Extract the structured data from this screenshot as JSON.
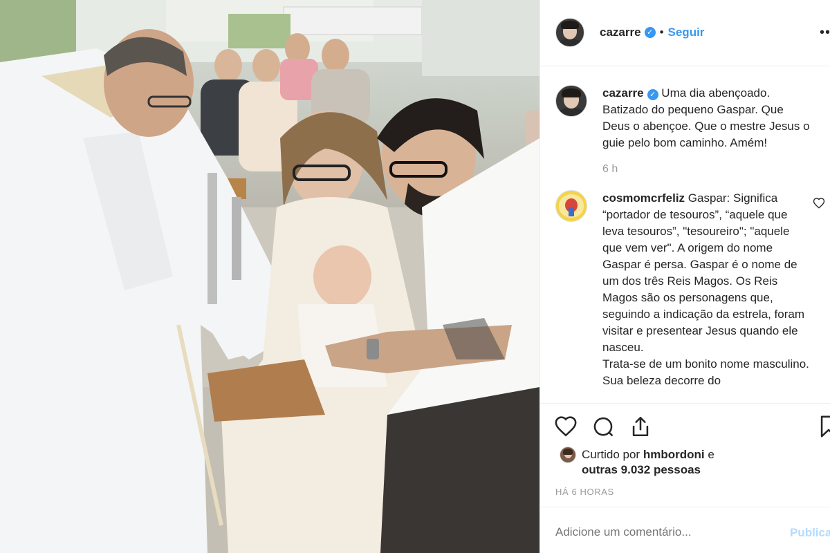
{
  "post": {
    "username": "cazarre",
    "verified_mark": "✓",
    "separator": "•",
    "follow_label": "Seguir",
    "more_icon": "•••"
  },
  "caption": {
    "username": "cazarre",
    "text": "Uma dia abençoado. Batizado do pequeno Gaspar. Que Deus o abençoe. Que o mestre Jesus o guie pelo bom caminho. Amém!",
    "time": "6 h"
  },
  "comments": [
    {
      "username": "cosmomcrfeliz",
      "text": "Gaspar: Significa “portador de tesouros”, “aquele que leva tesouros”, \"tesoureiro\"; \"aquele que vem ver\". A origem do nome Gaspar é persa. Gaspar é o nome de um dos três Reis Magos. Os Reis Magos são os personagens que, seguindo a indicação da estrela, foram visitar e presentear Jesus quando ele nasceu.",
      "text2": "Trata-se de um bonito nome masculino. Sua beleza decorre do"
    }
  ],
  "likes": {
    "prefix": "Curtido por",
    "user": "hmbordoni",
    "conj": "e",
    "others": "outras 9.032 pessoas"
  },
  "timestamp": "HÁ 6 HORAS",
  "add_comment": {
    "placeholder": "Adicione um comentário...",
    "publish_label": "Publicar"
  },
  "icons": {
    "like": "heart-icon",
    "comment": "comment-bubble-icon",
    "share": "share-icon",
    "save": "bookmark-icon",
    "comment_like": "small-heart-icon"
  },
  "colors": {
    "accent": "#3897f0",
    "verified": "#3897f0",
    "muted": "#999999",
    "publish_disabled": "#b3dbff"
  }
}
